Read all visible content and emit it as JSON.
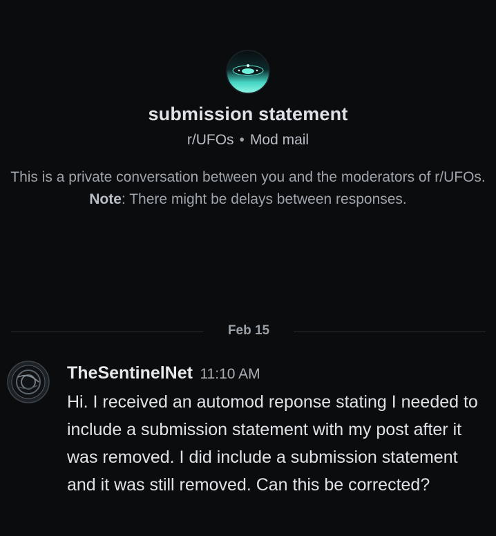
{
  "header": {
    "subreddit_icon": "ufo-icon",
    "title": "submission statement",
    "subreddit": "r/UFOs",
    "separator": "•",
    "channel": "Mod mail",
    "notice_prefix": "This is a private conversation between you and the moderators of r/UFOs. ",
    "notice_bold": "Note",
    "notice_suffix": ": There might be delays between responses."
  },
  "divider": {
    "date": "Feb 15"
  },
  "message": {
    "avatar_icon": "sentinel-avatar-icon",
    "username": "TheSentinelNet",
    "time": "11:10 AM",
    "text": "Hi. I received an automod reponse stating I needed to include a submission statement with my post after it was removed. I did include a submission statement and it was still removed. Can this be corrected?"
  },
  "colors": {
    "background": "#0b0c0e",
    "icon_teal": "#4fe3cf",
    "divider": "#2e3236"
  }
}
